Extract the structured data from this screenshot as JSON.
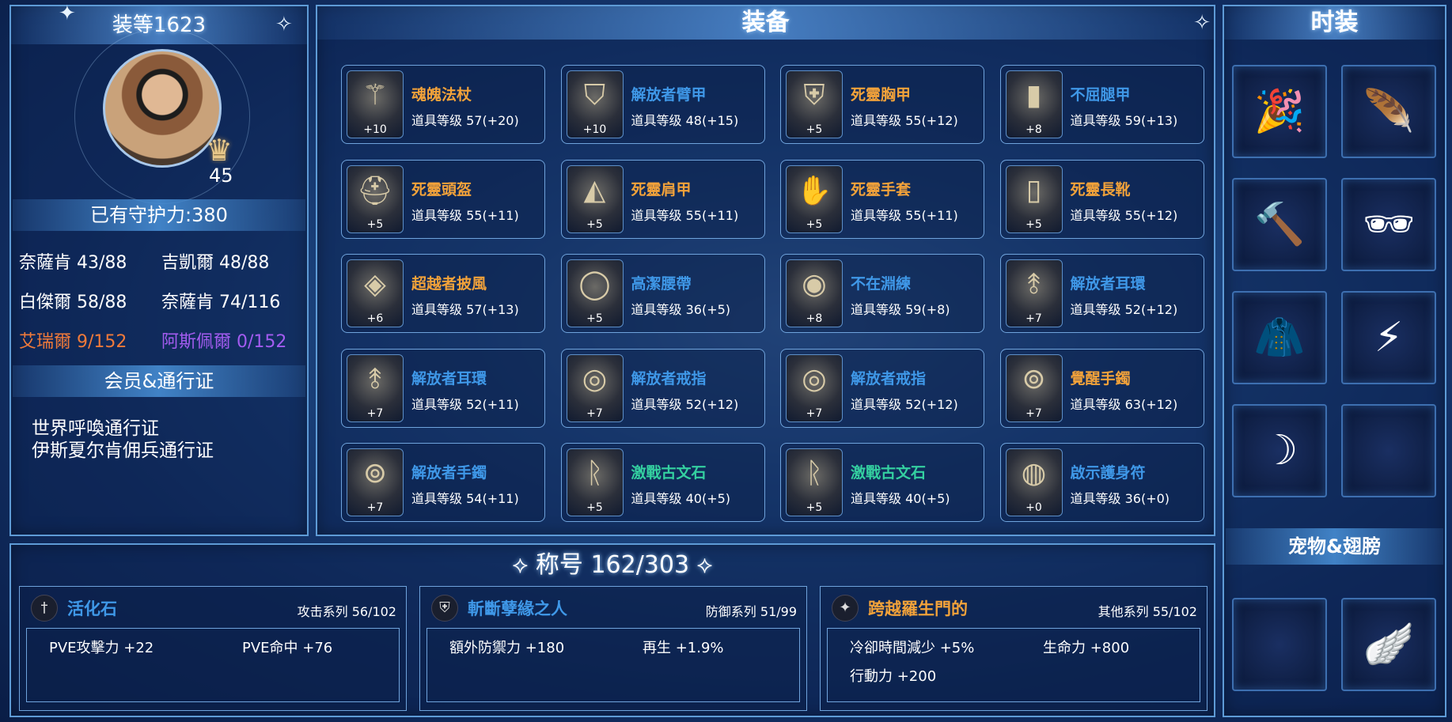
{
  "left_panel": {
    "level_title": "装等1623",
    "avatar_level": "45",
    "guardian_power": "已有守护力:380",
    "stats": [
      {
        "label": "奈薩肯 43/88",
        "color": "#ffffff"
      },
      {
        "label": "吉凱爾 48/88",
        "color": "#ffffff"
      },
      {
        "label": "白傑爾 58/88",
        "color": "#ffffff"
      },
      {
        "label": "奈薩肯 74/116",
        "color": "#ffffff"
      },
      {
        "label": "艾瑞爾 9/152",
        "color": "#f07a3a"
      },
      {
        "label": "阿斯佩爾 0/152",
        "color": "#a35cf0"
      }
    ],
    "membership_title": "会员&通行证",
    "passes": [
      "世界呼喚通行证",
      "伊斯夏尔肯佣兵通行证"
    ]
  },
  "equipment": {
    "title": "装备",
    "items": [
      {
        "name": "魂魄法杖",
        "level": "道具等级 57(+20)",
        "plus": "+10",
        "color": "orange",
        "icon": "staff-icon"
      },
      {
        "name": "解放者臂甲",
        "level": "道具等级 48(+15)",
        "plus": "+10",
        "color": "blue",
        "icon": "bracer-icon"
      },
      {
        "name": "死靈胸甲",
        "level": "道具等级 55(+12)",
        "plus": "+5",
        "color": "orange",
        "icon": "chestplate-icon"
      },
      {
        "name": "不屈腿甲",
        "level": "道具等级 59(+13)",
        "plus": "+8",
        "color": "blue",
        "icon": "leggings-icon"
      },
      {
        "name": "死靈頭盔",
        "level": "道具等级 55(+11)",
        "plus": "+5",
        "color": "orange",
        "icon": "helmet-icon"
      },
      {
        "name": "死靈肩甲",
        "level": "道具等级 55(+11)",
        "plus": "+5",
        "color": "orange",
        "icon": "shoulder-icon"
      },
      {
        "name": "死靈手套",
        "level": "道具等级 55(+11)",
        "plus": "+5",
        "color": "orange",
        "icon": "gloves-icon"
      },
      {
        "name": "死靈長靴",
        "level": "道具等级 55(+12)",
        "plus": "+5",
        "color": "orange",
        "icon": "boots-icon"
      },
      {
        "name": "超越者披風",
        "level": "道具等级 57(+13)",
        "plus": "+6",
        "color": "orange",
        "icon": "cape-icon"
      },
      {
        "name": "高潔腰帶",
        "level": "道具等级 36(+5)",
        "plus": "+5",
        "color": "blue",
        "icon": "belt-icon"
      },
      {
        "name": "不在淵練",
        "level": "道具等级 59(+8)",
        "plus": "+8",
        "color": "blue",
        "icon": "necklace-icon"
      },
      {
        "name": "解放者耳環",
        "level": "道具等级 52(+12)",
        "plus": "+7",
        "color": "blue",
        "icon": "earring-icon"
      },
      {
        "name": "解放者耳環",
        "level": "道具等级 52(+11)",
        "plus": "+7",
        "color": "blue",
        "icon": "earring-icon"
      },
      {
        "name": "解放者戒指",
        "level": "道具等级 52(+12)",
        "plus": "+7",
        "color": "blue",
        "icon": "ring-icon"
      },
      {
        "name": "解放者戒指",
        "level": "道具等级 52(+12)",
        "plus": "+7",
        "color": "blue",
        "icon": "ring-icon"
      },
      {
        "name": "覺醒手鐲",
        "level": "道具等级 63(+12)",
        "plus": "+7",
        "color": "orange",
        "icon": "bracelet-icon"
      },
      {
        "name": "解放者手鐲",
        "level": "道具等级 54(+11)",
        "plus": "+7",
        "color": "blue",
        "icon": "bracelet-icon"
      },
      {
        "name": "激戰古文石",
        "level": "道具等级 40(+5)",
        "plus": "+5",
        "color": "teal",
        "icon": "rune-stone-icon"
      },
      {
        "name": "激戰古文石",
        "level": "道具等级 40(+5)",
        "plus": "+5",
        "color": "teal",
        "icon": "rune-stone-icon"
      },
      {
        "name": "啟示護身符",
        "level": "道具等级 36(+0)",
        "plus": "+0",
        "color": "blue",
        "icon": "amulet-icon"
      }
    ]
  },
  "fashion": {
    "title": "时装",
    "slots": [
      {
        "icon": "party-hat-icon",
        "glyph": "🎉"
      },
      {
        "icon": "wing-icon",
        "glyph": "🪶"
      },
      {
        "icon": "hammer-icon",
        "glyph": "🔨"
      },
      {
        "icon": "sunglasses-icon",
        "glyph": "🕶"
      },
      {
        "icon": "coat-icon",
        "glyph": "🧥"
      },
      {
        "icon": "earring-icon",
        "glyph": "⚡"
      },
      {
        "icon": "halo-wing-icon",
        "glyph": "☽"
      },
      {
        "icon": "empty-slot-icon",
        "glyph": ""
      }
    ],
    "pet_title": "宠物&翅膀",
    "pet_slots": [
      {
        "icon": "empty-slot-icon",
        "glyph": ""
      },
      {
        "icon": "purple-wing-icon",
        "glyph": "🪽"
      }
    ]
  },
  "titles": {
    "header": "称号 162/303",
    "cards": [
      {
        "name": "活化石",
        "category": "攻击系列 56/102",
        "color": "blue",
        "icon": "sword-icon",
        "glyph": "†",
        "effects": [
          "PVE攻擊力 +22",
          "PVE命中 +76"
        ]
      },
      {
        "name": "斬斷孽緣之人",
        "category": "防御系列 51/99",
        "color": "blue",
        "icon": "shield-icon",
        "glyph": "⛨",
        "effects": [
          "額外防禦力 +180",
          "再生 +1.9%"
        ]
      },
      {
        "name": "跨越羅生門的",
        "category": "其他系列 55/102",
        "color": "orange",
        "icon": "star-icon",
        "glyph": "✦",
        "effects": [
          "冷卻時間減少 +5%",
          "生命力 +800",
          "行動力 +200"
        ]
      }
    ]
  }
}
